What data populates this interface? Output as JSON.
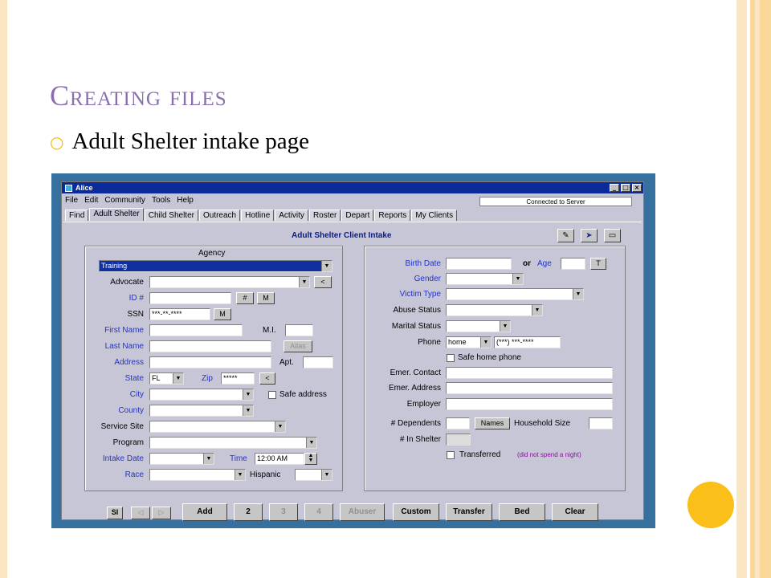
{
  "slide": {
    "title": "Creating files",
    "bullet": "Adult Shelter intake page"
  },
  "window": {
    "title": "Alice",
    "controls": [
      "_",
      "□",
      "×"
    ],
    "status": "Connected to Server"
  },
  "menu": [
    "File",
    "Edit",
    "Community",
    "Tools",
    "Help"
  ],
  "tabs": [
    "Find",
    "Adult Shelter",
    "Child Shelter",
    "Outreach",
    "Hotline",
    "Activity",
    "Roster",
    "Depart",
    "Reports",
    "My Clients"
  ],
  "active_tab": "Adult Shelter",
  "form": {
    "title": "Adult Shelter Client Intake",
    "agency_label": "Agency",
    "agency_value": "Training",
    "labels": {
      "advocate": "Advocate",
      "id": "ID #",
      "ssn": "SSN",
      "first_name": "First Name",
      "mi": "M.I.",
      "last_name": "Last Name",
      "address": "Address",
      "apt": "Apt.",
      "state": "State",
      "zip": "Zip",
      "city": "City",
      "county": "County",
      "service_site": "Service Site",
      "program": "Program",
      "intake_date": "Intake Date",
      "time": "Time",
      "race": "Race",
      "hispanic": "Hispanic",
      "safe_address": "Safe address",
      "birth_date": "Birth Date",
      "or": "or",
      "age": "Age",
      "gender": "Gender",
      "victim_type": "Victim Type",
      "abuse_status": "Abuse Status",
      "marital_status": "Marital Status",
      "phone": "Phone",
      "safe_home_phone": "Safe home phone",
      "emer_contact": "Emer. Contact",
      "emer_address": "Emer. Address",
      "employer": "Employer",
      "dependents": "# Dependents",
      "household_size": "Household Size",
      "in_shelter": "# In Shelter",
      "transferred": "Transferred",
      "transferred_note": "(did not spend a night)"
    },
    "values": {
      "ssn": "***-**-****",
      "state": "FL",
      "zip": "*****",
      "time": "12:00 AM",
      "phone_type": "home",
      "phone": "(***) ***-****"
    },
    "small_buttons": {
      "advocate_back": "<",
      "id_hash": "#",
      "id_m": "M",
      "ssn_m": "M",
      "alias": "Alias",
      "zip_back": "<",
      "age_t": "T",
      "names": "Names"
    }
  },
  "bottom_buttons": {
    "si": "SI",
    "prev": "◁",
    "next": "▷",
    "add": "Add",
    "two": "2",
    "three": "3",
    "four": "4",
    "abuser": "Abuser",
    "custom": "Custom",
    "transfer": "Transfer",
    "bed": "Bed",
    "clear": "Clear"
  },
  "colors": {
    "title_purple": "#8a6fb0",
    "bullet_gold": "#f5b800",
    "screenshot_border": "#36709e",
    "titlebar": "#0a2a9a",
    "label_blue": "#2233cc"
  }
}
